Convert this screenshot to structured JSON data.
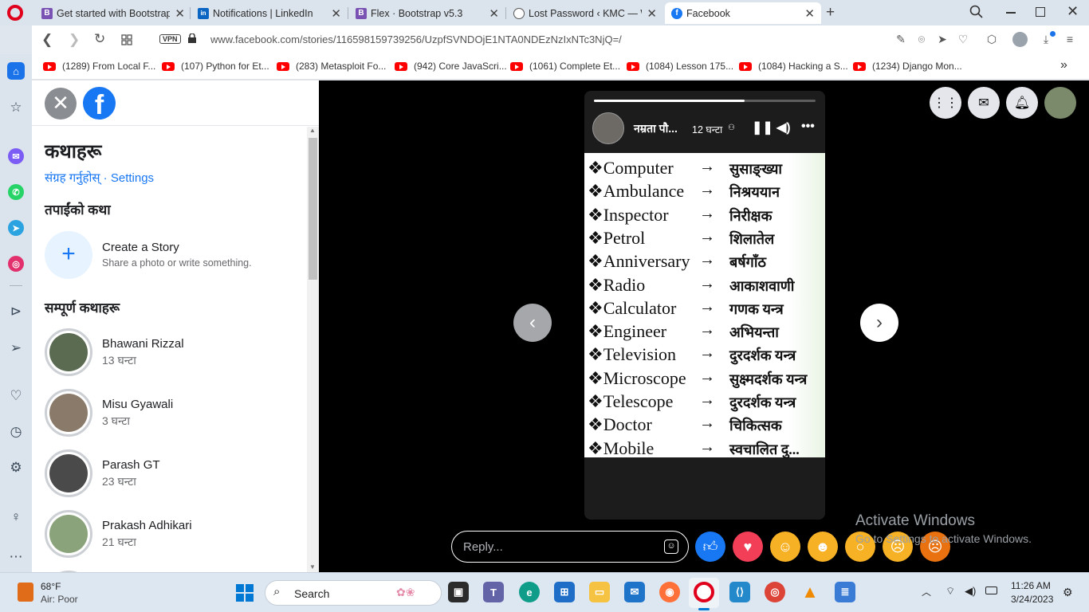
{
  "browser": {
    "tabs": [
      {
        "title": "Get started with Bootstrap",
        "favicon": "bootstrap-icon",
        "color": "#7952b3",
        "glyph": "B",
        "active": false
      },
      {
        "title": "Notifications | LinkedIn",
        "favicon": "linkedin-icon",
        "color": "#0a66c2",
        "glyph": "in",
        "active": false
      },
      {
        "title": "Flex · Bootstrap v5.3",
        "favicon": "bootstrap-icon",
        "color": "#7952b3",
        "glyph": "B",
        "active": false
      },
      {
        "title": "Lost Password ‹ KMC — We",
        "favicon": "globe-icon",
        "color": "#666666",
        "glyph": "◍",
        "active": false
      },
      {
        "title": "Facebook",
        "favicon": "facebook-icon",
        "color": "#1877f2",
        "glyph": "f",
        "active": true
      }
    ],
    "new_tab": "+",
    "url": "www.facebook.com/stories/116598159739256/UzpfSVNDOjE1NTA0NDEzNzIxNTc3NjQ=/",
    "vpn_label": "VPN",
    "bookmarks": [
      "(1289) From Local F...",
      "(107) Python for Et...",
      "(283) Metasploit Fo...",
      "(942) Core JavaScri...",
      "(1061) Complete Et...",
      "(1084) Lesson 175...",
      "(1084) Hacking a S...",
      "(1234) Django Mon..."
    ],
    "bookmarks_more": "»"
  },
  "stories_panel": {
    "title": "कथाहरू",
    "archive_link": "संग्रह गर्नुहोस्",
    "separator": " · ",
    "settings_link": "Settings",
    "your_story_heading": "तपाईंको कथा",
    "create_title": "Create a Story",
    "create_subtitle": "Share a photo or write something.",
    "all_stories_heading": "सम्पूर्ण कथाहरू",
    "stories": [
      {
        "name": "Bhawani Rizzal",
        "time": "13 घन्टा",
        "avatar_color": "#5a6b52"
      },
      {
        "name": "Misu Gyawali",
        "time": "3 घन्टा",
        "avatar_color": "#8a7a6a"
      },
      {
        "name": "Parash GT",
        "time": "23 घन्टा",
        "avatar_color": "#4a4a4a"
      },
      {
        "name": "Prakash Adhikari",
        "time": "21 घन्टा",
        "avatar_color": "#8aa37a"
      }
    ]
  },
  "viewer": {
    "author": "नम्रता पौ...",
    "time": "12 घन्टा",
    "progress": 0.68,
    "vocab": [
      {
        "en": "❖Computer",
        "np": "सुसाङ्ख्या"
      },
      {
        "en": "❖Ambulance",
        "np": "निश्रययान"
      },
      {
        "en": "❖Inspector",
        "np": "निरीक्षक"
      },
      {
        "en": "❖Petrol",
        "np": "शिलातेल"
      },
      {
        "en": "❖Anniversary",
        "np": "बर्षगाँठ"
      },
      {
        "en": "❖Radio",
        "np": "आकाशवाणी"
      },
      {
        "en": "❖Calculator",
        "np": "गणक यन्त्र"
      },
      {
        "en": "❖Engineer",
        "np": "अभियन्ता"
      },
      {
        "en": "❖Television",
        "np": "दुरदर्शक यन्त्र"
      },
      {
        "en": "❖Microscope",
        "np": "सुक्ष्मदर्शक यन्त्र"
      },
      {
        "en": "❖Telescope",
        "np": "दुरदर्शक यन्त्र"
      },
      {
        "en": "❖Doctor",
        "np": "चिकित्सक"
      },
      {
        "en": "❖Mobile",
        "np": "स्वचालित दु..."
      }
    ],
    "arrow_glyph": "→",
    "reply_placeholder": "Reply...",
    "reactions": [
      "like-icon",
      "love-icon",
      "care-icon",
      "haha-icon",
      "wow-icon",
      "sad-icon",
      "angry-icon"
    ],
    "watermark_title": "Activate Windows",
    "watermark_sub": "Go to Settings to activate Windows."
  },
  "taskbar": {
    "temperature": "68°F",
    "air": "Air: Poor",
    "search_label": "Search",
    "time": "11:26 AM",
    "date": "3/24/2023"
  }
}
